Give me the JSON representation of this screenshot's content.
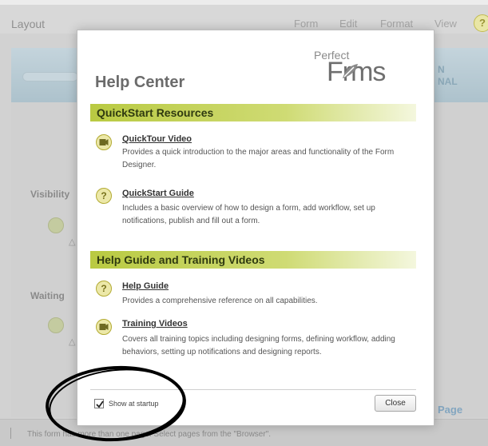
{
  "app": {
    "title": "Layout",
    "menu": [
      "Form",
      "Edit",
      "Format",
      "View"
    ],
    "help_glyph": "?",
    "banner_text": [
      "N",
      "NAL"
    ],
    "side_labels": [
      "Visibility",
      "Waiting"
    ],
    "page_link": "Page",
    "status_text": "This form has more than one page. Select pages from the \"Browser\"."
  },
  "dialog": {
    "title": "Help Center",
    "logo": {
      "small": "Perfect",
      "big": "Frms"
    },
    "sections": [
      {
        "title": "QuickStart Resources",
        "items": [
          {
            "icon": "video-icon",
            "link": "QuickTour Video",
            "desc": "Provides a quick introduction to the major areas and functionality of the Form Designer."
          },
          {
            "icon": "question-icon",
            "link": "QuickStart Guide",
            "desc": "Includes a basic overview of how to design a form, add workflow, set up notifications, publish and fill out a form."
          }
        ]
      },
      {
        "title": "Help Guide and Training Videos",
        "items": [
          {
            "icon": "question-icon",
            "link": "Help Guide",
            "desc": "Provides a comprehensive reference on all capabilities."
          },
          {
            "icon": "video-icon",
            "link": "Training Videos",
            "desc": "Covers all training topics including designing forms, defining workflow, adding behaviors, setting up notifications and designing reports."
          }
        ]
      }
    ],
    "show_at_startup": {
      "label": "Show at startup",
      "checked": true
    },
    "close_label": "Close"
  },
  "colors": {
    "section_bar": "#b9ca42",
    "annotation_circle": "#000000"
  }
}
